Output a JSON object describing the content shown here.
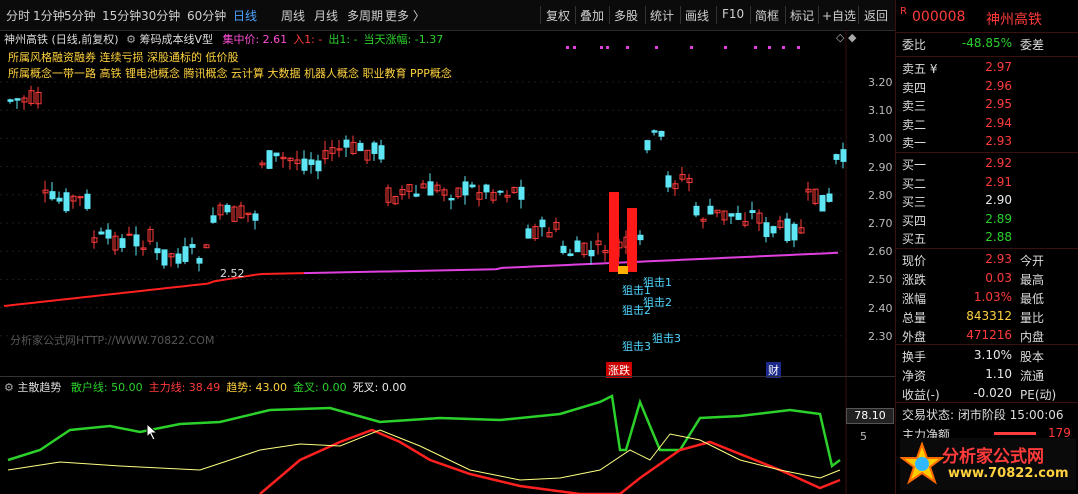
{
  "toolbar": {
    "periods": [
      "分时",
      "1分钟",
      "5分钟",
      "15分钟",
      "30分钟",
      "60分钟",
      "日线",
      "周线",
      "月线",
      "多周期",
      "更多 〉"
    ],
    "active_period": "日线",
    "actions": [
      "复权",
      "叠加",
      "多股",
      "统计",
      "画线",
      "F10",
      "简框",
      "标记",
      "+自选",
      "返回"
    ]
  },
  "stock_header": {
    "badge": "R",
    "code": "000008",
    "name": "神州高铁"
  },
  "chart_header": {
    "stock_label": "神州高铁 (日线,前复权)",
    "indicator_name": "筹码成本线V型",
    "items": [
      {
        "label": "集中价: 2.61",
        "color": "#ff4fd8"
      },
      {
        "label": "入1: -",
        "color": "#ff3b3b"
      },
      {
        "label": "出1: -",
        "color": "#2bd02b"
      },
      {
        "label": "当天涨幅: -1.37",
        "color": "#2bd02b"
      }
    ]
  },
  "concept_lines": {
    "style": "所属风格融资融券 连续亏损 深股通标的 低价股",
    "concept": "所属概念一带一路 高铁 锂电池概念 腾讯概念 云计算 大数据 机器人概念 职业教育 PPP概念"
  },
  "price_axis": [
    "3.20",
    "3.10",
    "3.00",
    "2.90",
    "2.80",
    "2.70",
    "2.60",
    "2.50",
    "2.40",
    "2.30"
  ],
  "annotations": {
    "low_label": "2.52",
    "snipe": [
      "狙击1",
      "狙击1",
      "狙击2",
      "狙击2",
      "狙击3",
      "狙击3"
    ],
    "markers": [
      "涨跌",
      "财"
    ]
  },
  "watermark": "分析家公式网HTTP://WWW.70822.COM",
  "sub_header": {
    "name": "主散趋势",
    "items": [
      {
        "label": "散户线: 50.00",
        "color": "#2bd02b"
      },
      {
        "label": "主力线: 38.49",
        "color": "#ff3b3b"
      },
      {
        "label": "趋势: 43.00",
        "color": "#ffd23f"
      },
      {
        "label": "金叉: 0.00",
        "color": "#2bd02b"
      },
      {
        "label": "死叉: 0.00",
        "color": "#e8e8e8"
      }
    ]
  },
  "sub_axis": {
    "value": "78.10",
    "tick": "5"
  },
  "quote": {
    "webi_label": "委比",
    "webi_value": "-48.85%",
    "wecha_label": "委差",
    "asks": [
      {
        "label": "卖五 ¥",
        "price": "2.97"
      },
      {
        "label": "卖四",
        "price": "2.96"
      },
      {
        "label": "卖三",
        "price": "2.95"
      },
      {
        "label": "卖二",
        "price": "2.94"
      },
      {
        "label": "卖一",
        "price": "2.93"
      }
    ],
    "bids": [
      {
        "label": "买一",
        "price": "2.92"
      },
      {
        "label": "买二",
        "price": "2.91"
      },
      {
        "label": "买三",
        "price": "2.90"
      },
      {
        "label": "买四",
        "price": "2.89"
      },
      {
        "label": "买五",
        "price": "2.88"
      }
    ],
    "stats": [
      {
        "l": "现价",
        "v": "2.93",
        "c": "red",
        "r": "今开"
      },
      {
        "l": "涨跌",
        "v": "0.03",
        "c": "red",
        "r": "最高"
      },
      {
        "l": "涨幅",
        "v": "1.03%",
        "c": "red",
        "r": "最低"
      },
      {
        "l": "总量",
        "v": "843312",
        "c": "yellow",
        "r": "量比"
      },
      {
        "l": "外盘",
        "v": "471216",
        "c": "red",
        "r": "内盘"
      },
      {
        "l": "换手",
        "v": "3.10%",
        "c": "white",
        "r": "股本"
      },
      {
        "l": "净资",
        "v": "1.10",
        "c": "white",
        "r": "流通"
      },
      {
        "l": "收益(-)",
        "v": "-0.020",
        "c": "white",
        "r": "PE(动)"
      }
    ],
    "trade_status": "交易状态: 闭市阶段 15:00:06",
    "net_label": "主力净额",
    "net_value": "179"
  },
  "logo": {
    "text": "分析家公式网",
    "url": "www.70822.com"
  }
}
